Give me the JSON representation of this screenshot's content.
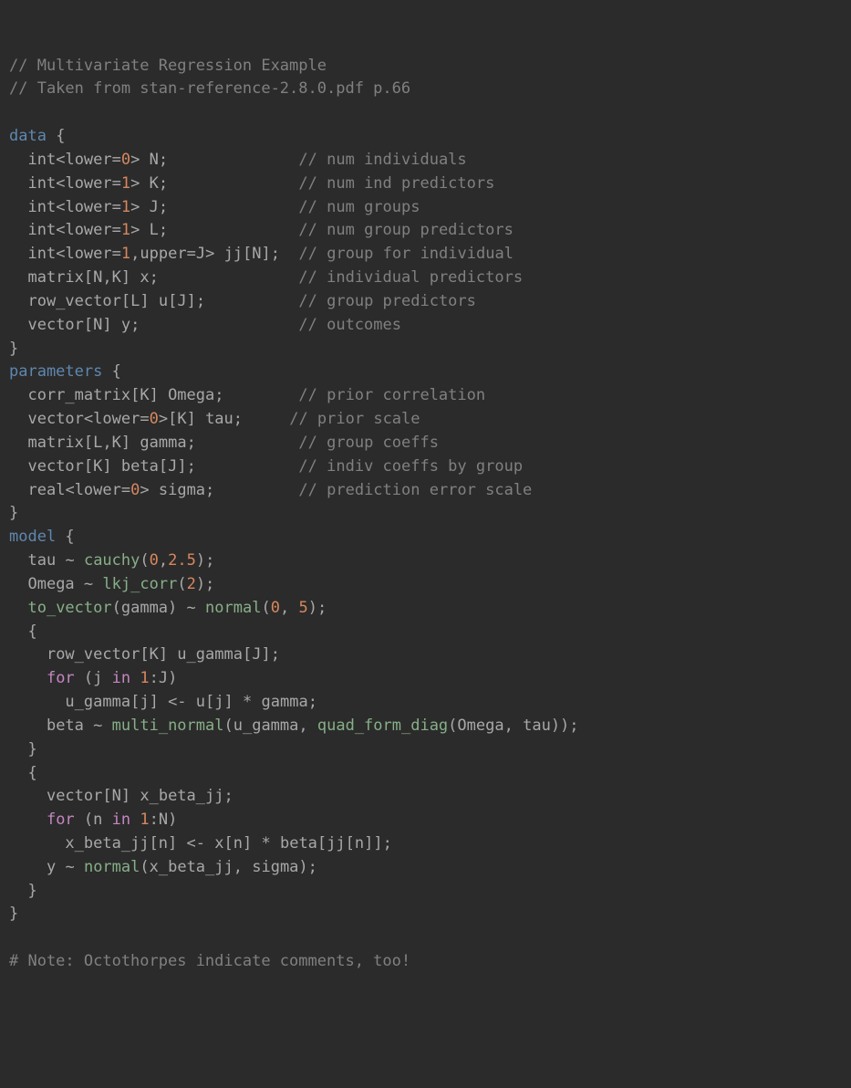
{
  "c1": "// Multivariate Regression Example",
  "c2": "// Taken from stan-reference-2.8.0.pdf p.66",
  "kw_data": "data",
  "ty_int": "int",
  "ty_matrix": "matrix",
  "ty_rowvec": "row_vector",
  "ty_vector": "vector",
  "ty_corrmat": "corr_matrix",
  "ty_real": "real",
  "lower": "lower",
  "upper": "upper",
  "n0": "0",
  "n1": "1",
  "n2": "2",
  "n2_5": "2.5",
  "n5": "5",
  "id_N": "N",
  "id_K": "K",
  "id_J": "J",
  "id_L": "L",
  "id_jj": "jj",
  "id_x": "x",
  "id_u": "u",
  "id_y": "y",
  "id_Omega": "Omega",
  "id_tau": "tau",
  "id_gamma": "gamma",
  "id_beta": "beta",
  "id_sigma": "sigma",
  "id_ugamma": "u_gamma",
  "id_j": "j",
  "id_n": "n",
  "id_xbetajj": "x_beta_jj",
  "cN": "// num individuals",
  "cK": "// num ind predictors",
  "cJ": "// num groups",
  "cL": "// num group predictors",
  "cjj": "// group for individual",
  "cx": "// individual predictors",
  "cu": "// group predictors",
  "cy": "// outcomes",
  "kw_params": "parameters",
  "cOmega": "// prior correlation",
  "ctau": "// prior scale",
  "cgamma": "// group coeffs",
  "cbeta": "// indiv coeffs by group",
  "csigma": "// prediction error scale",
  "kw_model": "model",
  "fn_cauchy": "cauchy",
  "fn_lkj": "lkj_corr",
  "fn_tovec": "to_vector",
  "fn_normal": "normal",
  "fn_multinorm": "multi_normal",
  "fn_qfd": "quad_form_diag",
  "ctl_for": "for",
  "ctl_in": "in",
  "tilde": "~",
  "assign": "<-",
  "cfoot": "# Note: Octothorpes indicate comments, too!"
}
